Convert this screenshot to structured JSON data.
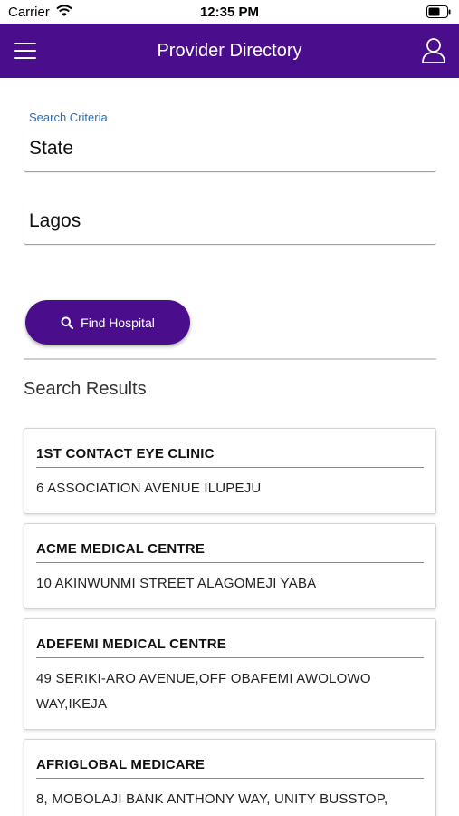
{
  "status_bar": {
    "carrier": "Carrier",
    "time": "12:35 PM",
    "wifi_icon": "wifi-icon",
    "battery_icon": "battery-icon"
  },
  "header": {
    "title": "Provider Directory",
    "menu_icon": "hamburger-menu-icon",
    "profile_icon": "user-profile-icon",
    "background_color": "#4a0d8c"
  },
  "form": {
    "criteria_label": "Search Criteria",
    "state_value": "State",
    "city_value": "Lagos",
    "find_button_label": "Find Hospital",
    "find_button_icon": "search-icon"
  },
  "results": {
    "title": "Search Results",
    "items": [
      {
        "name": "1ST CONTACT EYE CLINIC",
        "address": "6 ASSOCIATION AVENUE ILUPEJU"
      },
      {
        "name": "ACME MEDICAL CENTRE",
        "address": "10 AKINWUNMI STREET ALAGOMEJI YABA"
      },
      {
        "name": "ADEFEMI MEDICAL CENTRE",
        "address": "49 SERIKI-ARO AVENUE,OFF OBAFEMI AWOLOWO WAY,IKEJA"
      },
      {
        "name": "AFRIGLOBAL MEDICARE",
        "address": "8, MOBOLAJI BANK ANTHONY WAY, UNITY BUSSTOP,"
      }
    ]
  },
  "colors": {
    "accent": "#4a0d8c",
    "label_blue": "#2a6db5"
  }
}
